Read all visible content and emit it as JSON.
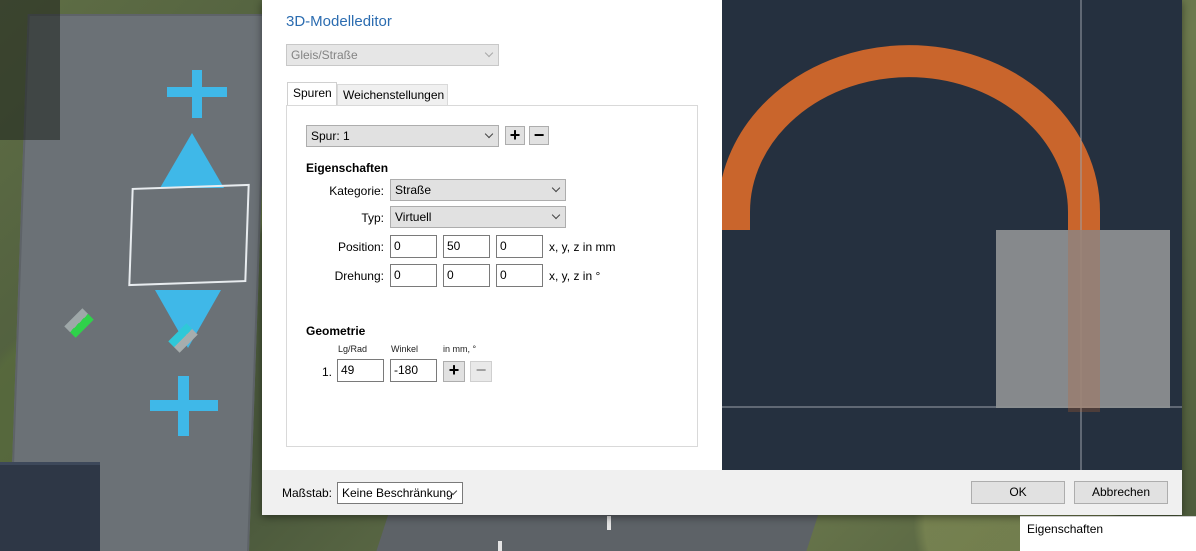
{
  "dialog": {
    "title": "3D-Modelleditor",
    "type_select": "Gleis/Straße",
    "tabs": [
      "Spuren",
      "Weichenstellungen"
    ],
    "track_select": "Spur: 1",
    "properties": {
      "heading": "Eigenschaften",
      "category_label": "Kategorie:",
      "category_value": "Straße",
      "type_label": "Typ:",
      "type_value": "Virtuell",
      "position_label": "Position:",
      "position": [
        "0",
        "50",
        "0"
      ],
      "position_unit": "x, y, z in mm",
      "rotation_label": "Drehung:",
      "rotation": [
        "0",
        "0",
        "0"
      ],
      "rotation_unit": "x, y, z in °"
    },
    "geometry": {
      "heading": "Geometrie",
      "col_length": "Lg/Rad",
      "col_angle": "Winkel",
      "col_unit": "in mm, °",
      "rows": [
        {
          "index": "1.",
          "length": "49",
          "angle": "-180"
        }
      ]
    },
    "footer": {
      "scale_label": "Maßstab:",
      "scale_value": "Keine Beschränkung",
      "ok": "OK",
      "cancel": "Abbrechen"
    }
  },
  "side_panel": {
    "title": "Eigenschaften"
  },
  "icons": {
    "plus": "+",
    "minus": "−"
  },
  "colors": {
    "title_blue": "#2b6cb0",
    "preview_bg": "#25303f",
    "track_orange": "#c9652c",
    "gizmo_blue": "#3fb8e8"
  }
}
